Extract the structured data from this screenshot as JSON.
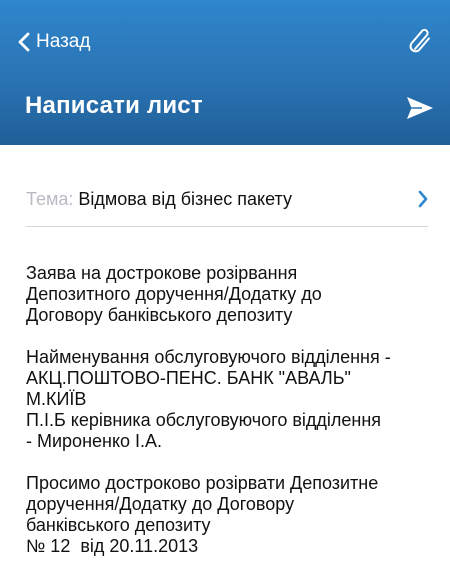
{
  "header": {
    "back_label": "Назад",
    "title": "Написати лист",
    "colors": {
      "gradient_top": "#2f86cc",
      "gradient_bottom": "#1f5f98",
      "text": "#ffffff"
    },
    "icons": {
      "back": "chevron-left-icon",
      "attach": "paperclip-icon",
      "send": "send-icon"
    }
  },
  "subject": {
    "label": "Тема:",
    "value": "Відмова від бізнес пакету",
    "chevron_color": "#2f86cc"
  },
  "body": {
    "paragraphs": [
      [
        "Заява на дострокове розірвання",
        "Депозитного доручення/Додатку до",
        "Договору банківського депозиту"
      ],
      [
        "Найменування обслуговуючого відділення -",
        "АКЦ.ПОШТОВО-ПЕНС. БАНК \"АВАЛЬ\"",
        "М.КИЇВ",
        "П.І.Б керівника обслуговуючого відділення",
        "- Мироненко І.А."
      ],
      [
        "Просимо достроково розірвати Депозитне",
        "доручення/Додатку до Договору",
        "банківського депозиту",
        "№ 12  від 20.11.2013"
      ]
    ]
  }
}
